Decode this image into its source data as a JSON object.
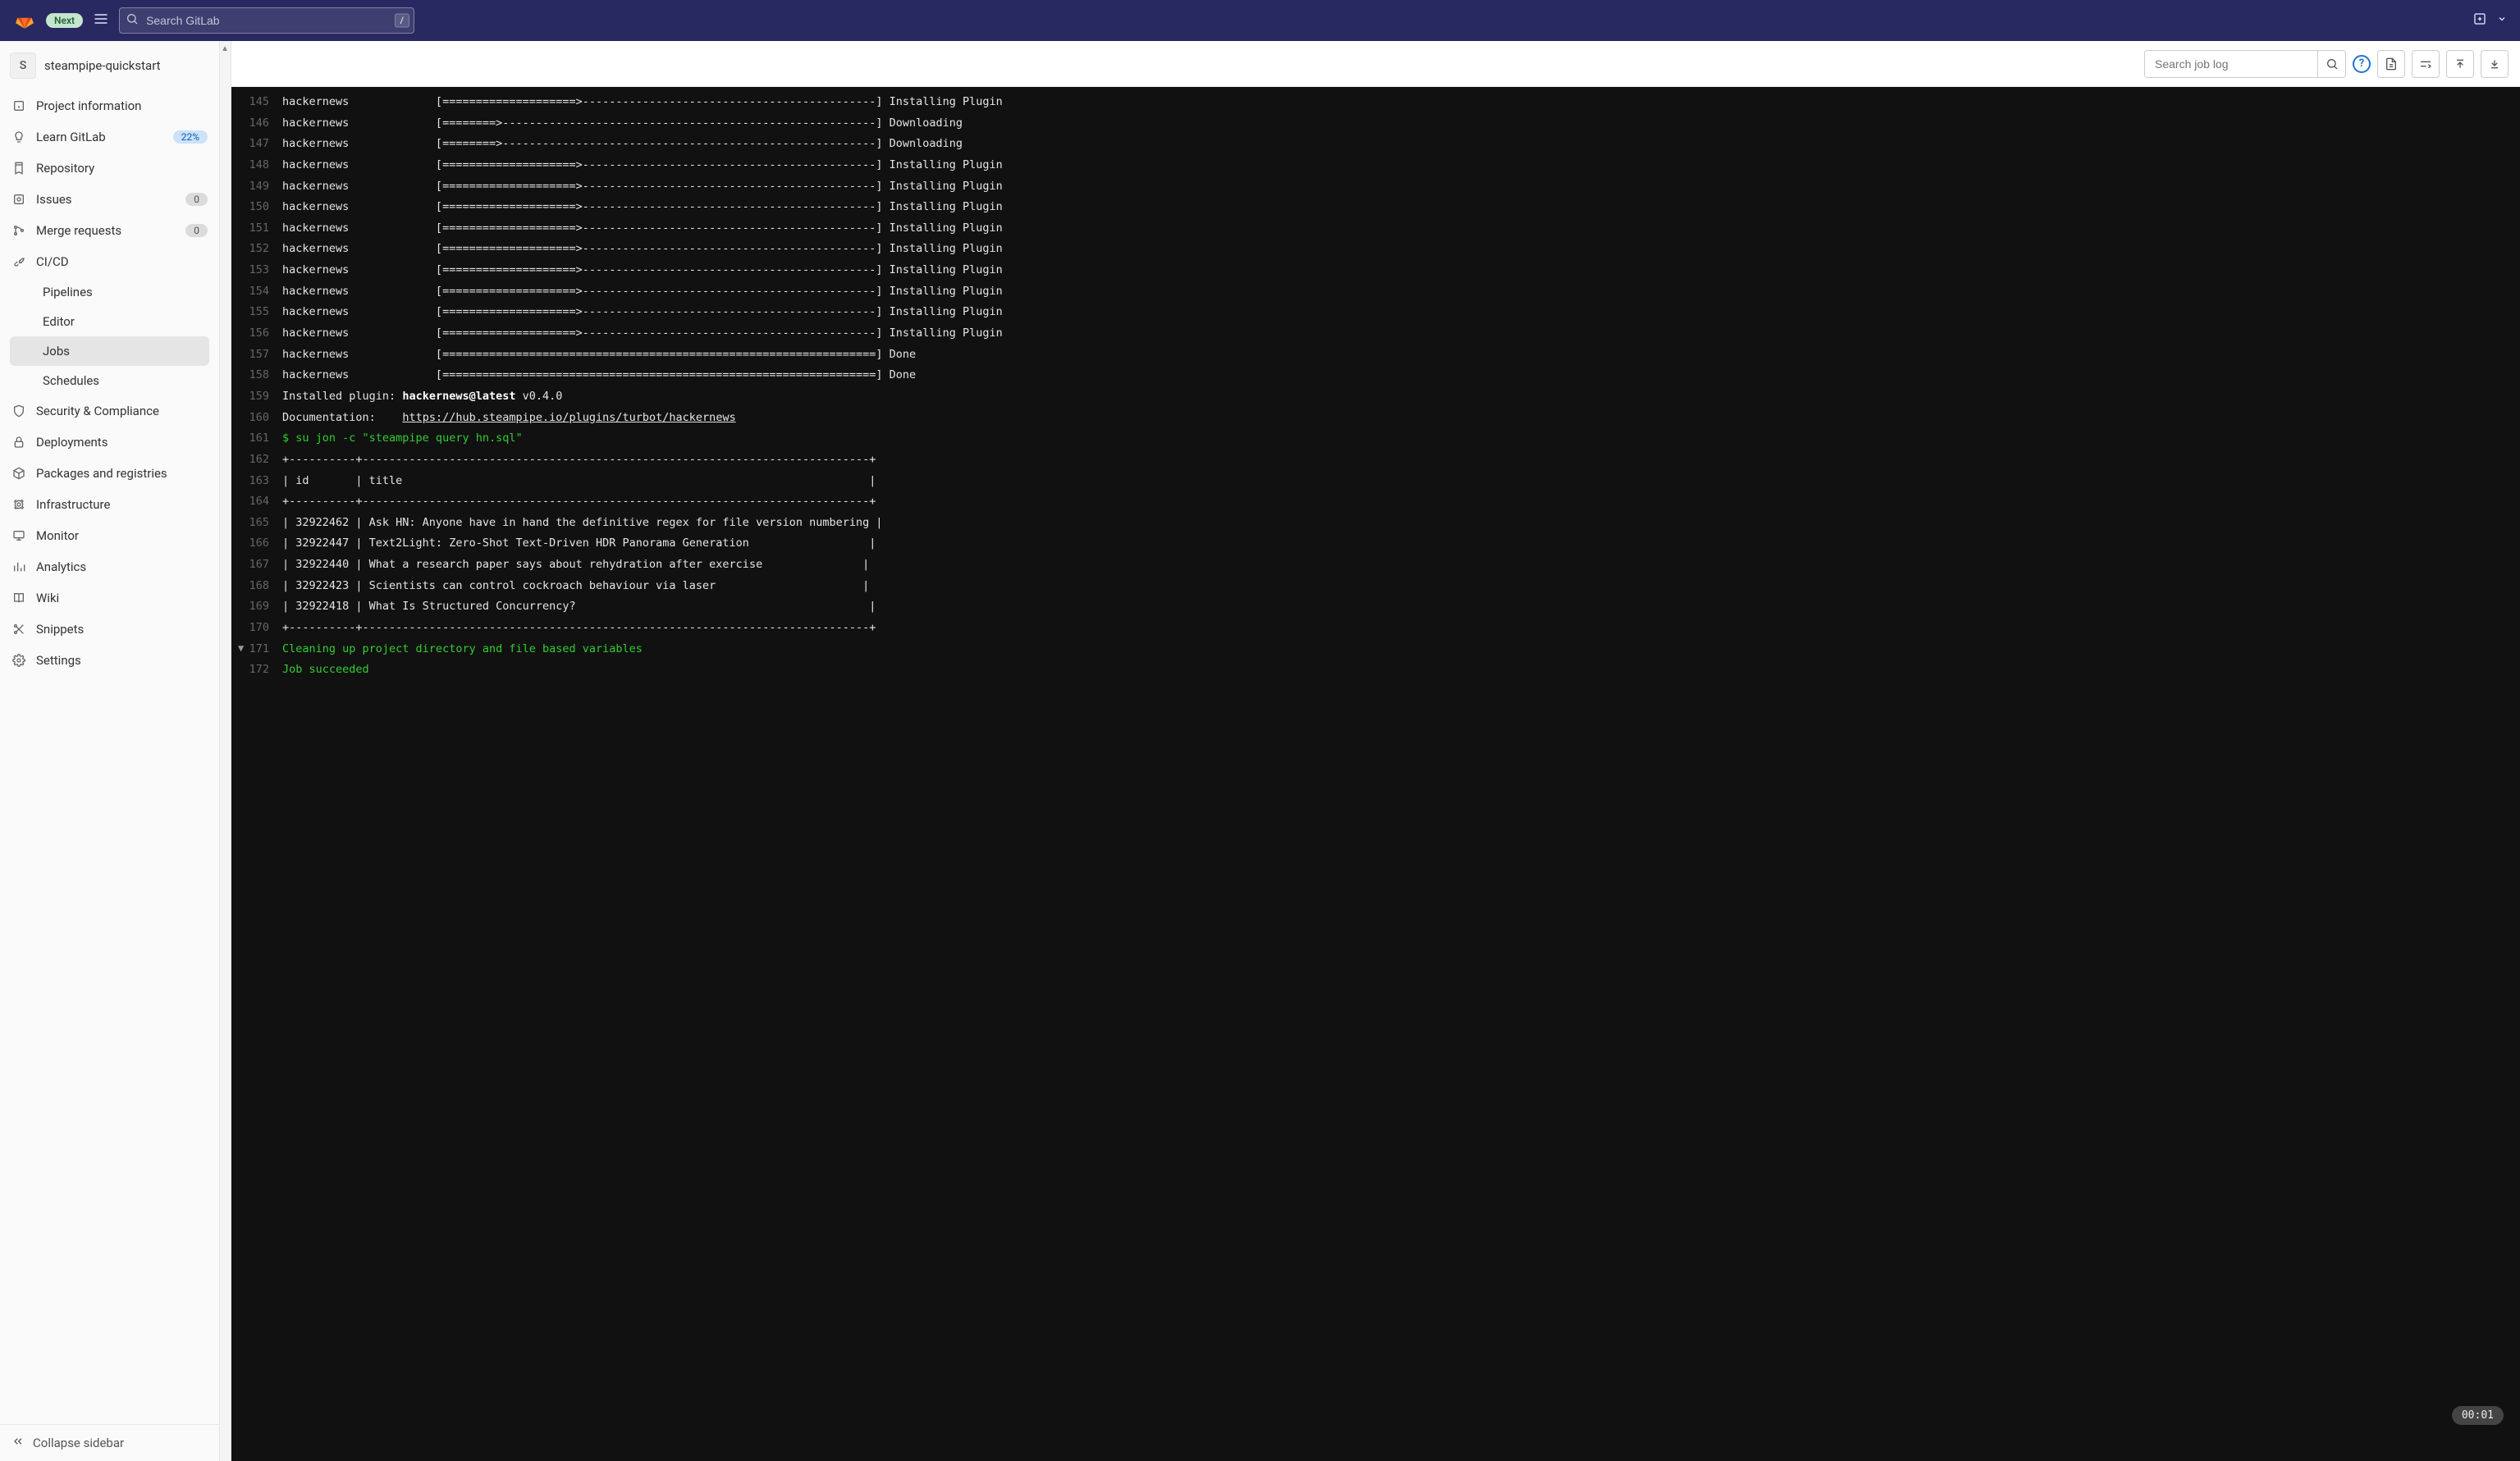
{
  "topbar": {
    "badge": "Next",
    "search_placeholder": "Search GitLab",
    "search_key": "/"
  },
  "project": {
    "avatar_letter": "S",
    "name": "steampipe-quickstart"
  },
  "sidebar": {
    "items": [
      {
        "icon": "info",
        "label": "Project information"
      },
      {
        "icon": "bulb",
        "label": "Learn GitLab",
        "badge": "22%",
        "badge_class": "blue"
      },
      {
        "icon": "repo",
        "label": "Repository"
      },
      {
        "icon": "issues",
        "label": "Issues",
        "badge": "0"
      },
      {
        "icon": "merge",
        "label": "Merge requests",
        "badge": "0"
      },
      {
        "icon": "rocket",
        "label": "CI/CD",
        "expanded": true,
        "children": [
          {
            "label": "Pipelines"
          },
          {
            "label": "Editor"
          },
          {
            "label": "Jobs",
            "active": true
          },
          {
            "label": "Schedules"
          }
        ]
      },
      {
        "icon": "shield",
        "label": "Security & Compliance"
      },
      {
        "icon": "deploy",
        "label": "Deployments"
      },
      {
        "icon": "package",
        "label": "Packages and registries"
      },
      {
        "icon": "infra",
        "label": "Infrastructure"
      },
      {
        "icon": "monitor",
        "label": "Monitor"
      },
      {
        "icon": "analytics",
        "label": "Analytics"
      },
      {
        "icon": "wiki",
        "label": "Wiki"
      },
      {
        "icon": "snippets",
        "label": "Snippets"
      },
      {
        "icon": "settings",
        "label": "Settings"
      }
    ],
    "collapse_label": "Collapse sidebar"
  },
  "toolbar": {
    "joblog_placeholder": "Search job log",
    "help_char": "?"
  },
  "log": {
    "lines": [
      {
        "n": 145,
        "html": "hackernews             [====================>--------------------------------------------] Installing Plugin"
      },
      {
        "n": 146,
        "html": "hackernews             [========>--------------------------------------------------------] Downloading"
      },
      {
        "n": 147,
        "html": "hackernews             [========>--------------------------------------------------------] Downloading"
      },
      {
        "n": 148,
        "html": "hackernews             [====================>--------------------------------------------] Installing Plugin"
      },
      {
        "n": 149,
        "html": "hackernews             [====================>--------------------------------------------] Installing Plugin"
      },
      {
        "n": 150,
        "html": "hackernews             [====================>--------------------------------------------] Installing Plugin"
      },
      {
        "n": 151,
        "html": "hackernews             [====================>--------------------------------------------] Installing Plugin"
      },
      {
        "n": 152,
        "html": "hackernews             [====================>--------------------------------------------] Installing Plugin"
      },
      {
        "n": 153,
        "html": "hackernews             [====================>--------------------------------------------] Installing Plugin"
      },
      {
        "n": 154,
        "html": "hackernews             [====================>--------------------------------------------] Installing Plugin"
      },
      {
        "n": 155,
        "html": "hackernews             [====================>--------------------------------------------] Installing Plugin"
      },
      {
        "n": 156,
        "html": "hackernews             [====================>--------------------------------------------] Installing Plugin"
      },
      {
        "n": 157,
        "html": "hackernews             [=================================================================] Done"
      },
      {
        "n": 158,
        "html": "hackernews             [=================================================================] Done"
      },
      {
        "n": 159,
        "html": "Installed plugin: <span class=\"bold\">hackernews@latest</span> v0.4.0"
      },
      {
        "n": 160,
        "html": "Documentation:    <a>https://hub.steampipe.io/plugins/turbot/hackernews</a>"
      },
      {
        "n": 161,
        "cls": "green",
        "html": "$ su jon -c \"steampipe query hn.sql\""
      },
      {
        "n": 162,
        "html": "+----------+----------------------------------------------------------------------------+"
      },
      {
        "n": 163,
        "html": "| id       | title                                                                      |"
      },
      {
        "n": 164,
        "html": "+----------+----------------------------------------------------------------------------+"
      },
      {
        "n": 165,
        "html": "| 32922462 | Ask HN: Anyone have in hand the definitive regex for file version numbering |"
      },
      {
        "n": 166,
        "html": "| 32922447 | Text2Light: Zero-Shot Text-Driven HDR Panorama Generation                  |"
      },
      {
        "n": 167,
        "html": "| 32922440 | What a research paper says about rehydration after exercise               |"
      },
      {
        "n": 168,
        "html": "| 32922423 | Scientists can control cockroach behaviour via laser                      |"
      },
      {
        "n": 169,
        "html": "| 32922418 | What Is Structured Concurrency?                                            |"
      },
      {
        "n": 170,
        "html": "+----------+----------------------------------------------------------------------------+"
      },
      {
        "n": 171,
        "cls": "green",
        "chevron": true,
        "html": "Cleaning up project directory and file based variables"
      },
      {
        "n": 172,
        "cls": "green",
        "html": "Job succeeded"
      }
    ],
    "timer": "00:01"
  },
  "chart_data": {
    "type": "table",
    "title": "steampipe query hn.sql",
    "columns": [
      "id",
      "title"
    ],
    "rows": [
      [
        32922462,
        "Ask HN: Anyone have in hand the definitive regex for file version numbering"
      ],
      [
        32922447,
        "Text2Light: Zero-Shot Text-Driven HDR Panorama Generation"
      ],
      [
        32922440,
        "What a research paper says about rehydration after exercise"
      ],
      [
        32922423,
        "Scientists can control cockroach behaviour via laser"
      ],
      [
        32922418,
        "What Is Structured Concurrency?"
      ]
    ]
  }
}
